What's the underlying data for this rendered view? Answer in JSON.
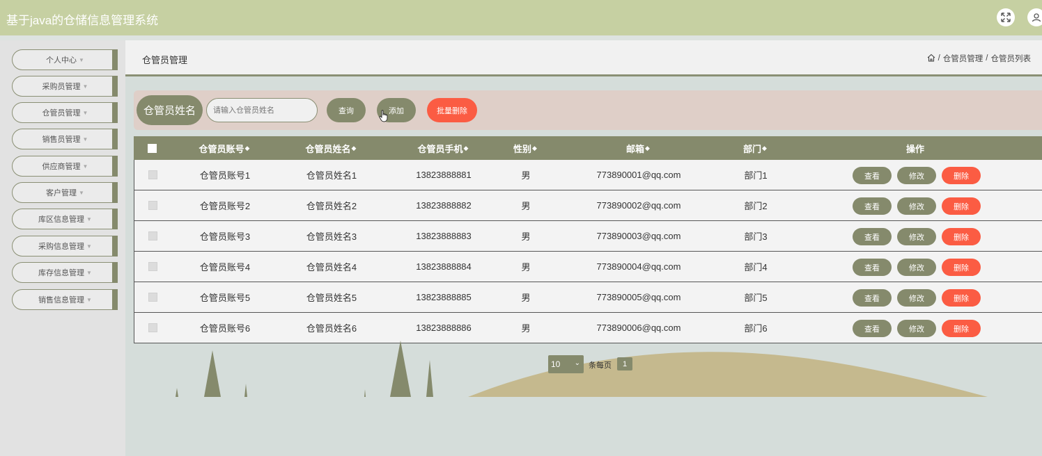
{
  "app": {
    "title": "基于java的仓储信息管理系统"
  },
  "topbar": {
    "icons": [
      "fullscreen-icon",
      "user-icon"
    ]
  },
  "sidebar": {
    "items": [
      {
        "label": "个人中心"
      },
      {
        "label": "采购员管理"
      },
      {
        "label": "仓管员管理"
      },
      {
        "label": "销售员管理"
      },
      {
        "label": "供应商管理"
      },
      {
        "label": "客户管理"
      },
      {
        "label": "库区信息管理"
      },
      {
        "label": "采购信息管理"
      },
      {
        "label": "库存信息管理"
      },
      {
        "label": "销售信息管理"
      }
    ]
  },
  "header": {
    "title": "仓管员管理",
    "breadcrumb": {
      "home_icon": "home-icon",
      "sep": "/",
      "level1": "仓管员管理",
      "level2": "仓管员列表"
    }
  },
  "search": {
    "label": "仓管员姓名",
    "placeholder": "请输入仓管员姓名",
    "value": "",
    "query_label": "查询",
    "add_label": "添加",
    "batch_delete_label": "批量删除"
  },
  "table": {
    "columns": [
      "仓管员账号",
      "仓管员姓名",
      "仓管员手机",
      "性别",
      "邮箱",
      "部门",
      "操作"
    ],
    "rows": [
      {
        "account": "仓管员账号1",
        "name": "仓管员姓名1",
        "phone": "13823888881",
        "gender": "男",
        "email": "773890001@qq.com",
        "dept": "部门1"
      },
      {
        "account": "仓管员账号2",
        "name": "仓管员姓名2",
        "phone": "13823888882",
        "gender": "男",
        "email": "773890002@qq.com",
        "dept": "部门2"
      },
      {
        "account": "仓管员账号3",
        "name": "仓管员姓名3",
        "phone": "13823888883",
        "gender": "男",
        "email": "773890003@qq.com",
        "dept": "部门3"
      },
      {
        "account": "仓管员账号4",
        "name": "仓管员姓名4",
        "phone": "13823888884",
        "gender": "男",
        "email": "773890004@qq.com",
        "dept": "部门4"
      },
      {
        "account": "仓管员账号5",
        "name": "仓管员姓名5",
        "phone": "13823888885",
        "gender": "男",
        "email": "773890005@qq.com",
        "dept": "部门5"
      },
      {
        "account": "仓管员账号6",
        "name": "仓管员姓名6",
        "phone": "13823888886",
        "gender": "男",
        "email": "773890006@qq.com",
        "dept": "部门6"
      }
    ],
    "actions": {
      "view": "查看",
      "edit": "修改",
      "delete": "删除"
    }
  },
  "pagination": {
    "page_size": "10",
    "per_page_label": "条每页",
    "current_page": "1"
  },
  "colors": {
    "topbar": "#c6d0a2",
    "olive": "#858a6c",
    "danger": "#fb5c43",
    "search_bg": "#dfcfc8",
    "hill": "#c5b98e"
  }
}
